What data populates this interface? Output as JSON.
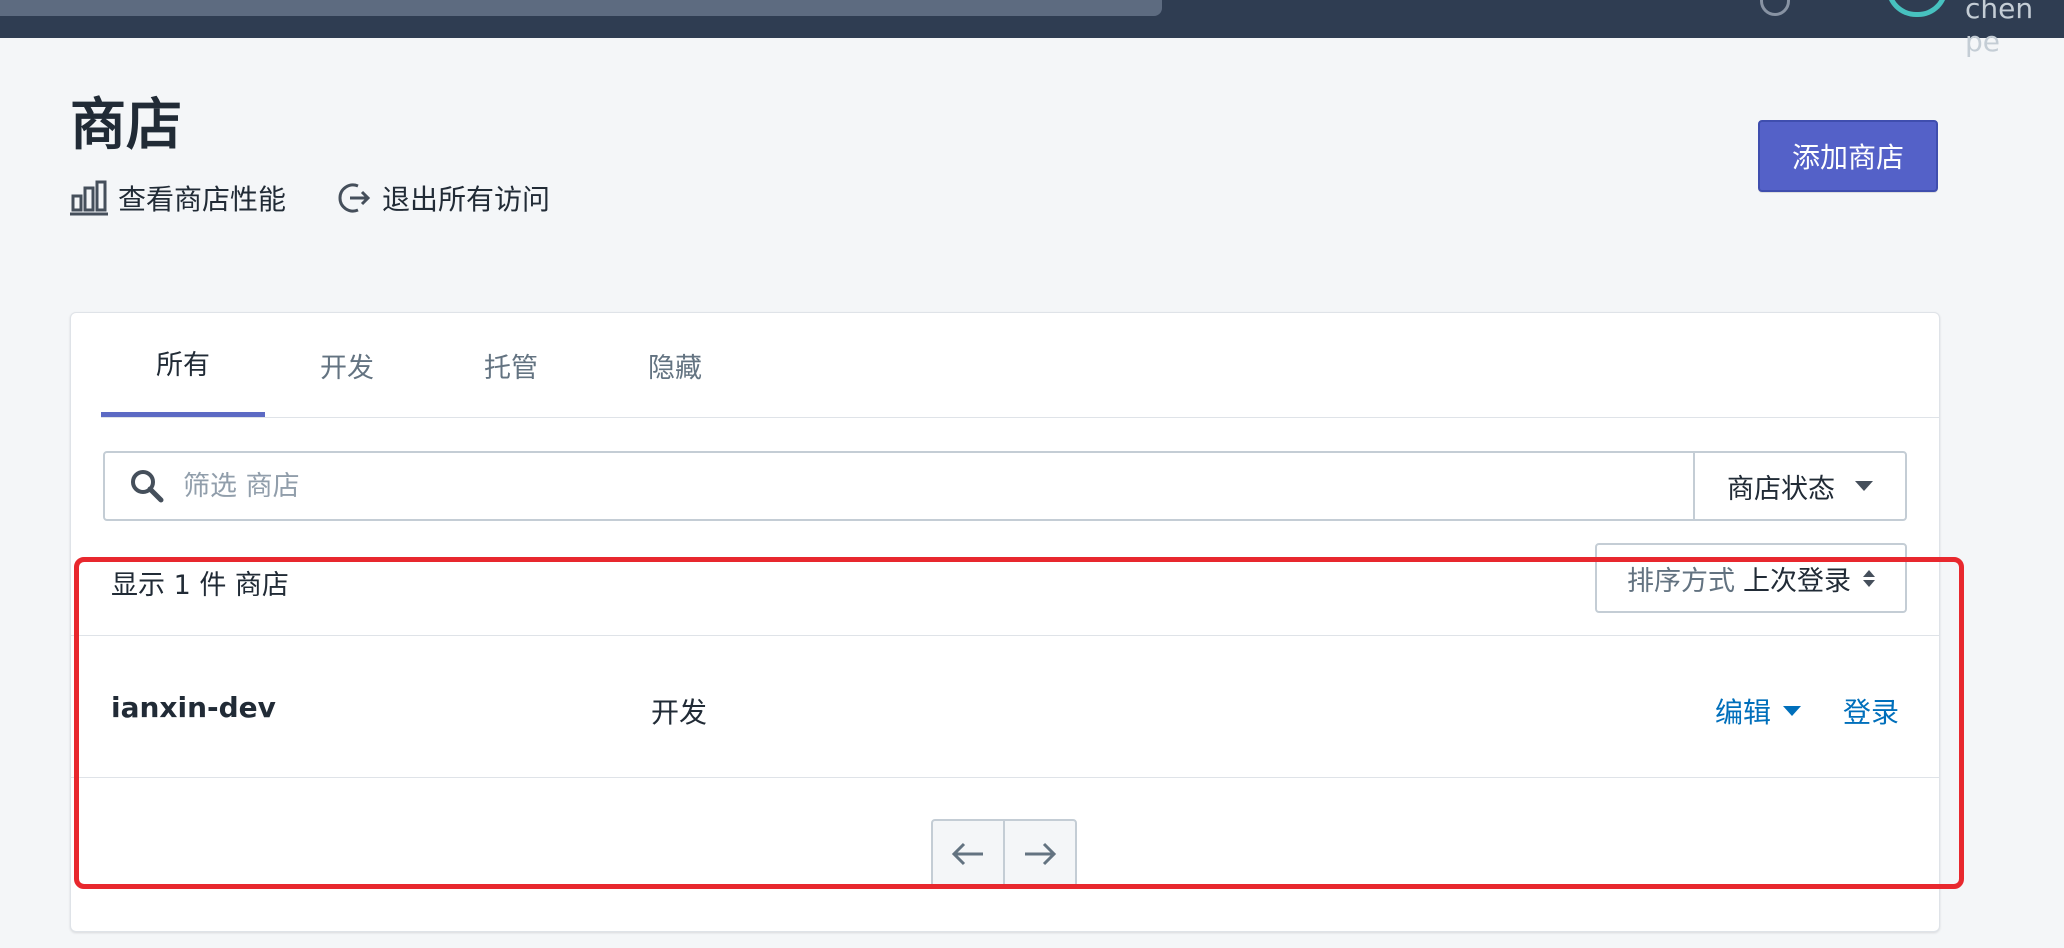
{
  "topbar": {
    "username": "chen pe"
  },
  "page": {
    "title": "商店"
  },
  "actions": {
    "view_performance": "查看商店性能",
    "logout_all": "退出所有访问"
  },
  "header": {
    "add_store_label": "添加商店"
  },
  "tabs": [
    {
      "label": "所有",
      "active": true
    },
    {
      "label": "开发",
      "active": false
    },
    {
      "label": "托管",
      "active": false
    },
    {
      "label": "隐藏",
      "active": false
    }
  ],
  "filter": {
    "placeholder": "筛选 商店",
    "status_label": "商店状态"
  },
  "results": {
    "count_text": "显示 1 件 商店",
    "sort_label": "排序方式",
    "sort_value": "上次登录"
  },
  "stores": [
    {
      "name": "ianxin-dev",
      "type": "开发",
      "edit_label": "编辑",
      "login_label": "登录"
    }
  ],
  "colors": {
    "accent": "#5c6ac4",
    "link": "#006fbb",
    "highlight": "#e8282e",
    "topbar": "#2f3d52"
  }
}
